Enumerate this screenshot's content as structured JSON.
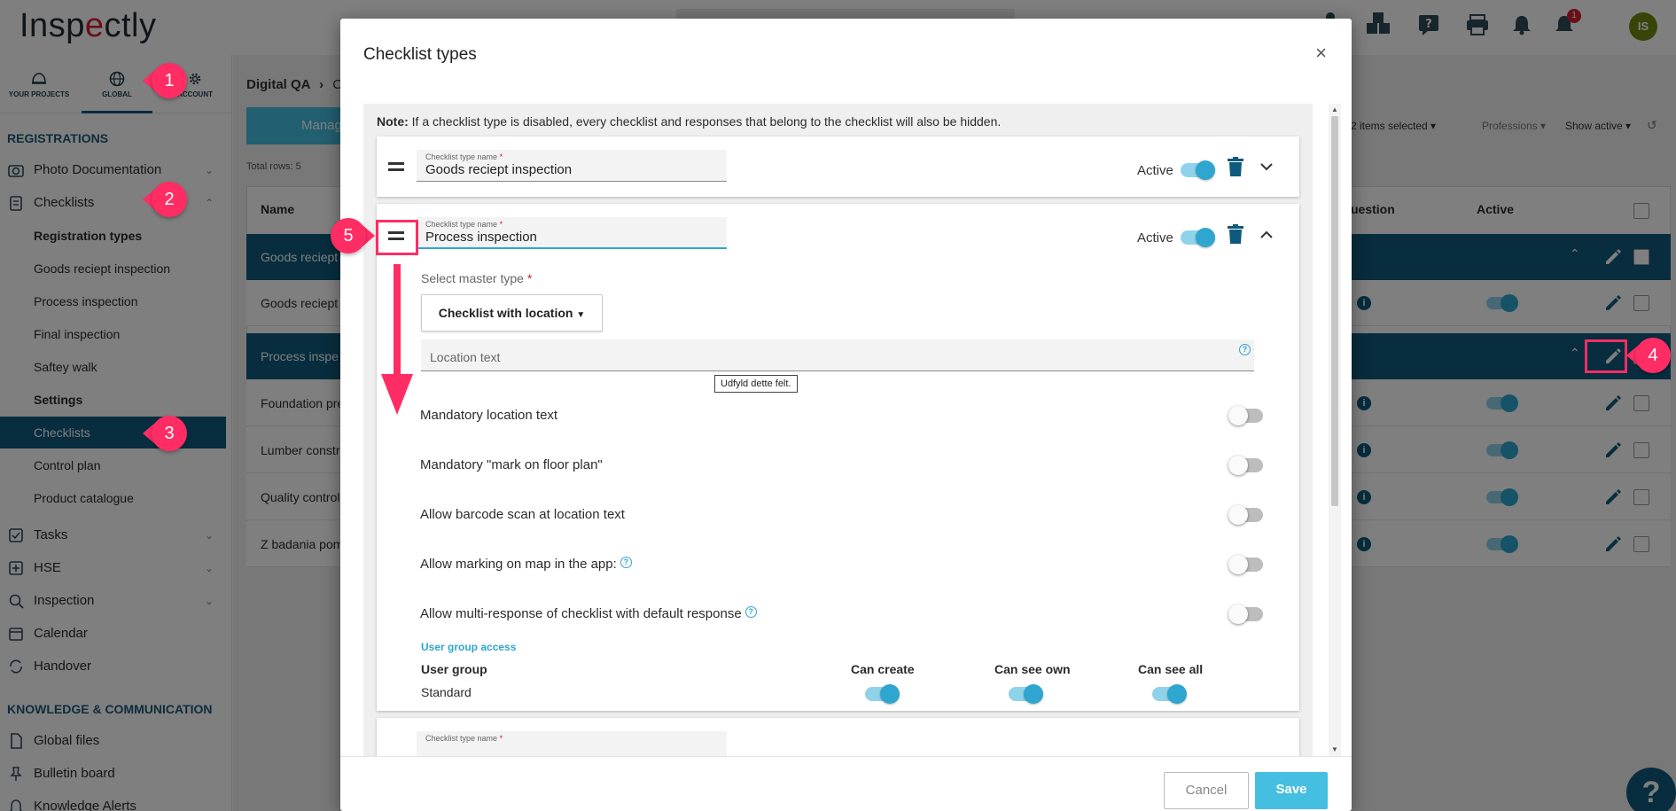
{
  "app": {
    "logo_text_a": "Insp",
    "logo_text_b": "e",
    "logo_text_c": "ctly",
    "avatar_initials": "IS",
    "notification_count": "1"
  },
  "navtabs": [
    {
      "label": "YOUR PROJECTS"
    },
    {
      "label": "GLOBAL"
    },
    {
      "label": "ACCOUNT"
    }
  ],
  "sidebar": {
    "registrations_title": "REGISTRATIONS",
    "items": [
      {
        "label": "Photo Documentation"
      },
      {
        "label": "Checklists"
      }
    ],
    "sub_items": [
      {
        "label": "Registration types"
      },
      {
        "label": "Goods reciept inspection"
      },
      {
        "label": "Process inspection"
      },
      {
        "label": "Final inspection"
      },
      {
        "label": "Saftey walk"
      },
      {
        "label": "Settings"
      },
      {
        "label": "Checklists"
      },
      {
        "label": "Control plan"
      },
      {
        "label": "Product catalogue"
      }
    ],
    "more_items": [
      {
        "label": "Tasks"
      },
      {
        "label": "HSE"
      },
      {
        "label": "Inspection"
      },
      {
        "label": "Calendar"
      },
      {
        "label": "Handover"
      }
    ],
    "knowledge_title": "KNOWLEDGE & COMMUNICATION",
    "knowledge_items": [
      {
        "label": "Global files"
      },
      {
        "label": "Bulletin board"
      },
      {
        "label": "Knowledge Alerts"
      }
    ]
  },
  "main": {
    "breadcrumb_a": "Digital QA",
    "breadcrumb_b": "C",
    "manage_btn": "Manag",
    "total_rows": "Total rows: 5",
    "filter_items": "2 items selected",
    "filter_professions": "Professions",
    "filter_active": "Show active",
    "col_name": "Name",
    "col_question": "uestion",
    "col_active": "Active",
    "rows": [
      {
        "label": "Goods reciept",
        "type": "group"
      },
      {
        "label": "Goods reciept",
        "type": "row"
      },
      {
        "label": "Process inspe",
        "type": "group"
      },
      {
        "label": "Foundation pre",
        "type": "row"
      },
      {
        "label": "Lumber constr",
        "type": "row"
      },
      {
        "label": "Quality control",
        "type": "row"
      },
      {
        "label": "Z badania pom",
        "type": "row"
      }
    ]
  },
  "modal": {
    "title": "Checklist types",
    "close": "×",
    "note_bold": "Note:",
    "note_text": " If a checklist type is disabled, every checklist and responses that belong to the checklist will also be hidden.",
    "field_label": "Checklist type name",
    "required_mark": "*",
    "card1_name": "Goods reciept inspection",
    "card2_name": "Process inspection",
    "active_label": "Active",
    "master_type_label": "Select master type",
    "master_type_value": "Checklist with location",
    "location_text_placeholder": "Location text",
    "tooltip": "Udfyld dette felt.",
    "options": [
      {
        "label": "Mandatory location text",
        "on": false
      },
      {
        "label": "Mandatory \"mark on floor plan\"",
        "on": false
      },
      {
        "label": "Allow barcode scan at location text",
        "on": false
      },
      {
        "label": "Allow marking on map in the app:",
        "on": false,
        "help": true
      },
      {
        "label": "Allow multi-response of checklist with default response",
        "on": false,
        "help": true
      }
    ],
    "user_group_access": "User group access",
    "ug_header": "User group",
    "can_create": "Can create",
    "can_see_own": "Can see own",
    "can_see_all": "Can see all",
    "ug_row": "Standard",
    "cancel": "Cancel",
    "save": "Save"
  },
  "annotations": [
    "1",
    "2",
    "3",
    "4",
    "5"
  ],
  "colors": {
    "brand": "#0e5a7c",
    "accent": "#2ea6cf",
    "annotation": "#ff2d64",
    "save": "#45bfe1"
  }
}
